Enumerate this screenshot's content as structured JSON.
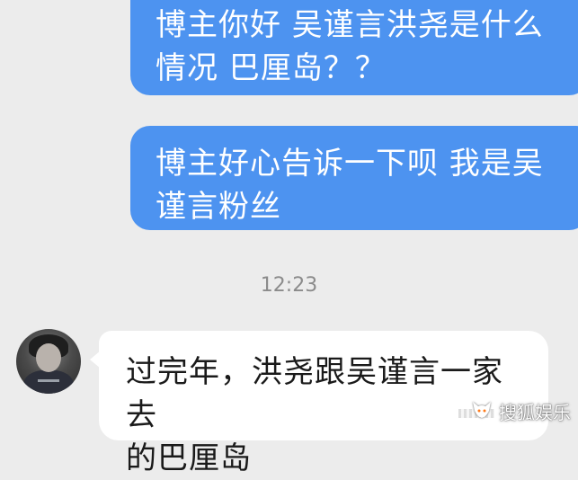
{
  "chat": {
    "messages": [
      {
        "direction": "outgoing",
        "text_lines": [
          "博主你好  吴谨言洪尧是什么",
          "情况  巴厘岛？？"
        ]
      },
      {
        "direction": "outgoing",
        "text_lines": [
          "博主好心告诉一下呗 我是吴",
          "谨言粉丝"
        ]
      },
      {
        "direction": "incoming",
        "text_lines": [
          "过完年，洪尧跟吴谨言一家去",
          "的巴厘岛"
        ]
      }
    ],
    "timestamp": "12:23"
  },
  "watermark": {
    "icon": "sohu-fox-icon",
    "text": "搜狐娱乐"
  },
  "colors": {
    "background": "#ececec",
    "outgoing_bubble": "#4d93f0",
    "incoming_bubble": "#ffffff",
    "timestamp": "#8b8b8b"
  }
}
